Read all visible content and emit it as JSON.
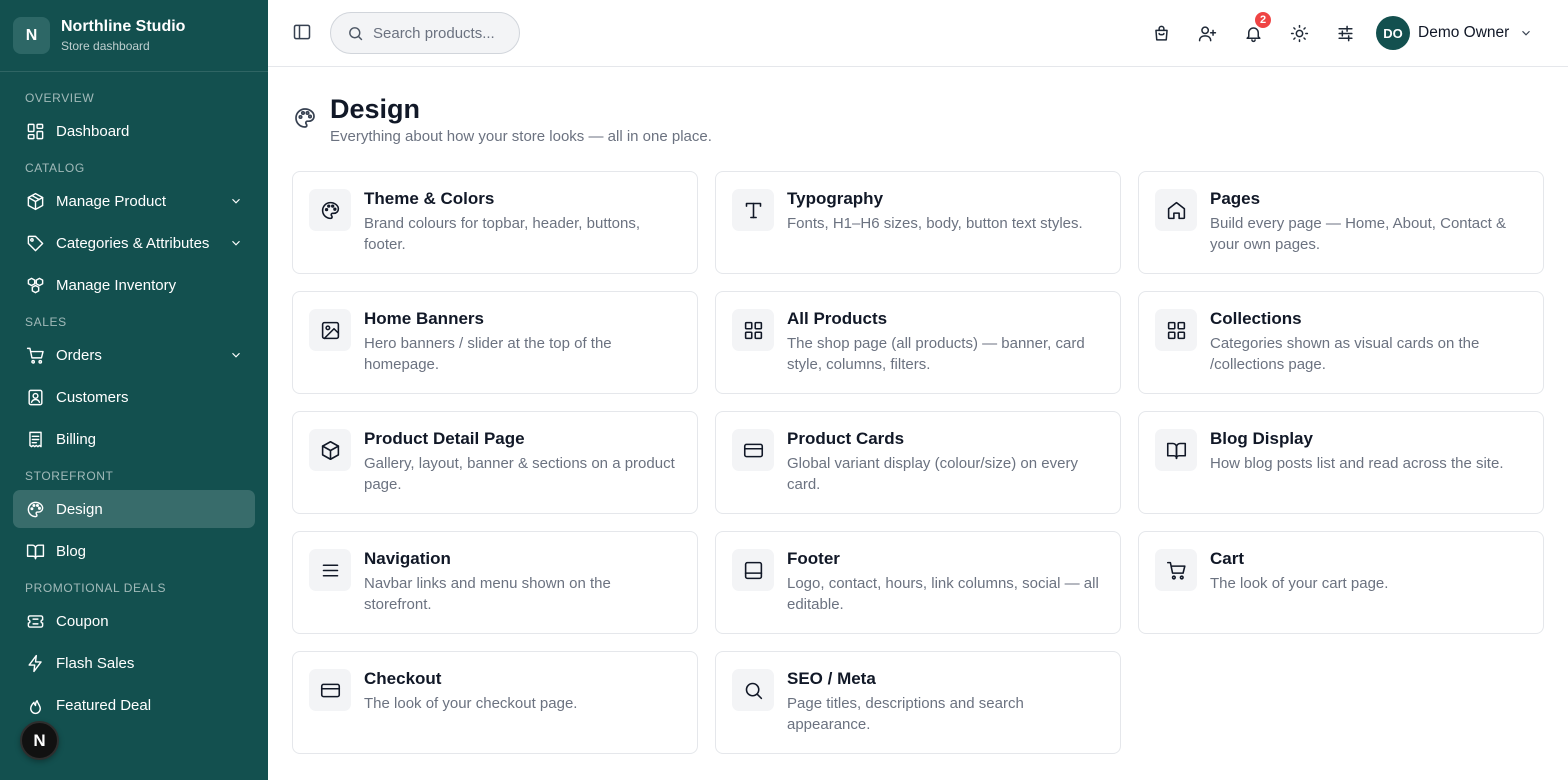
{
  "brand": {
    "initial": "N",
    "name": "Northline Studio",
    "subtitle": "Store dashboard"
  },
  "sidebar": {
    "sections": [
      {
        "label": "OVERVIEW",
        "items": [
          {
            "label": "Dashboard",
            "icon": "dashboard-icon"
          }
        ]
      },
      {
        "label": "CATALOG",
        "items": [
          {
            "label": "Manage Product",
            "icon": "box-icon",
            "chevron": true
          },
          {
            "label": "Categories & Attributes",
            "icon": "tag-icon",
            "chevron": true
          },
          {
            "label": "Manage Inventory",
            "icon": "inventory-icon"
          }
        ]
      },
      {
        "label": "SALES",
        "items": [
          {
            "label": "Orders",
            "icon": "cart-icon",
            "chevron": true
          },
          {
            "label": "Customers",
            "icon": "customers-icon"
          },
          {
            "label": "Billing",
            "icon": "billing-icon"
          }
        ]
      },
      {
        "label": "STOREFRONT",
        "items": [
          {
            "label": "Design",
            "icon": "palette-icon",
            "active": true
          },
          {
            "label": "Blog",
            "icon": "book-icon"
          }
        ]
      },
      {
        "label": "PROMOTIONAL DEALS",
        "items": [
          {
            "label": "Coupon",
            "icon": "ticket-icon"
          },
          {
            "label": "Flash Sales",
            "icon": "zap-icon"
          },
          {
            "label": "Featured Deal",
            "icon": "flame-icon"
          }
        ]
      }
    ],
    "floating_badge": "N"
  },
  "topbar": {
    "search_placeholder": "Search products...",
    "notification_count": "2",
    "user": {
      "initials": "DO",
      "name": "Demo Owner"
    }
  },
  "page": {
    "title": "Design",
    "subtitle": "Everything about how your store looks — all in one place."
  },
  "cards": [
    {
      "title": "Theme & Colors",
      "desc": "Brand colours for topbar, header, buttons, footer.",
      "icon": "palette-icon"
    },
    {
      "title": "Typography",
      "desc": "Fonts, H1–H6 sizes, body, button text styles.",
      "icon": "type-icon"
    },
    {
      "title": "Pages",
      "desc": "Build every page — Home, About, Contact & your own pages.",
      "icon": "home-icon"
    },
    {
      "title": "Home Banners",
      "desc": "Hero banners / slider at the top of the homepage.",
      "icon": "image-icon"
    },
    {
      "title": "All Products",
      "desc": "The shop page (all products) — banner, card style, columns, filters.",
      "icon": "grid-icon"
    },
    {
      "title": "Collections",
      "desc": "Categories shown as visual cards on the /collections page.",
      "icon": "grid-icon"
    },
    {
      "title": "Product Detail Page",
      "desc": "Gallery, layout, banner & sections on a product page.",
      "icon": "package-icon"
    },
    {
      "title": "Product Cards",
      "desc": "Global variant display (colour/size) on every card.",
      "icon": "card-icon"
    },
    {
      "title": "Blog Display",
      "desc": "How blog posts list and read across the site.",
      "icon": "book-icon"
    },
    {
      "title": "Navigation",
      "desc": "Navbar links and menu shown on the storefront.",
      "icon": "menu-icon"
    },
    {
      "title": "Footer",
      "desc": "Logo, contact, hours, link columns, social — all editable.",
      "icon": "footer-icon"
    },
    {
      "title": "Cart",
      "desc": "The look of your cart page.",
      "icon": "cart-icon"
    },
    {
      "title": "Checkout",
      "desc": "The look of your checkout page.",
      "icon": "card-icon"
    },
    {
      "title": "SEO / Meta",
      "desc": "Page titles, descriptions and search appearance.",
      "icon": "search-icon"
    }
  ],
  "colors": {
    "sidebar_bg": "#13504f",
    "accent": "#13504f",
    "badge": "#ef4444"
  }
}
